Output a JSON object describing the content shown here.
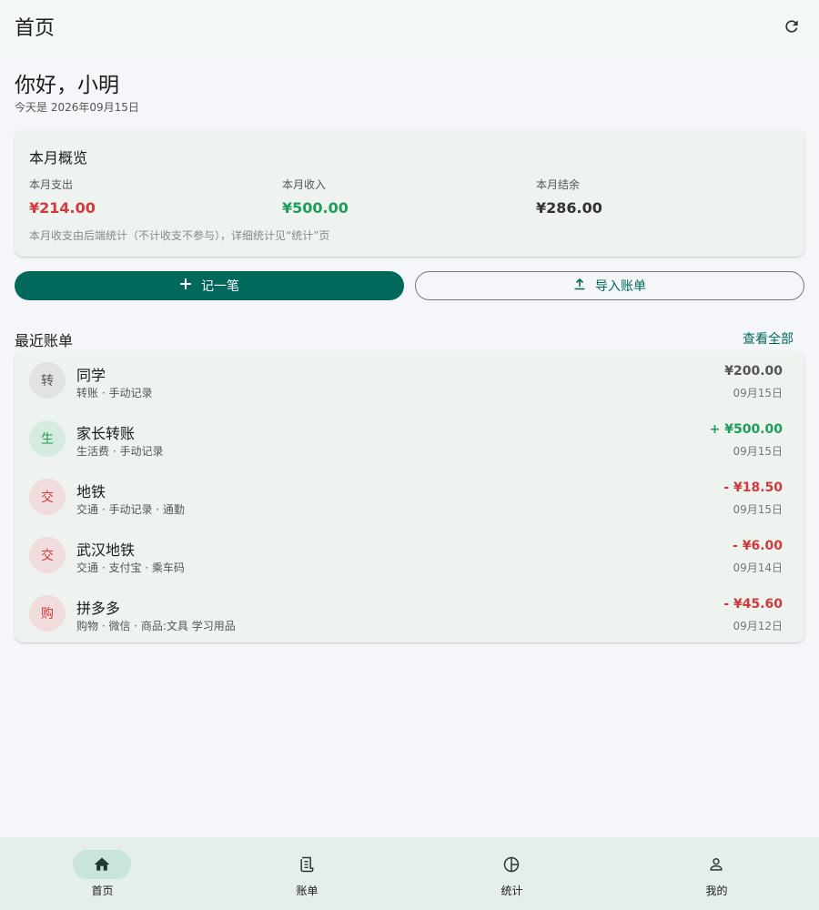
{
  "appbar": {
    "title": "首页",
    "refresh_icon": "refresh-icon"
  },
  "greeting": "你好，小明",
  "date_line": "今天是 2026年09月15日",
  "summary": {
    "title": "本月概览",
    "expense_label": "本月支出",
    "expense_value": "¥214.00",
    "income_label": "本月收入",
    "income_value": "¥500.00",
    "balance_label": "本月结余",
    "balance_value": "¥286.00",
    "note": "本月收支由后端统计（不计收支不参与），详细统计见“统计”页"
  },
  "actions": {
    "add_label": "记一笔",
    "add_icon": "plus-icon",
    "import_label": "导入账单",
    "import_icon": "upload-icon"
  },
  "recent": {
    "title": "最近账单",
    "view_all": "查看全部",
    "items": [
      {
        "avatar": "转",
        "name": "同学",
        "sub": "转账 · 手动记录",
        "amount": "¥200.00",
        "date": "09月15日",
        "kind": "neutral",
        "avatar_type": "transfer"
      },
      {
        "avatar": "生",
        "name": "家长转账",
        "sub": "生活费 · 手动记录",
        "amount": "+ ¥500.00",
        "date": "09月15日",
        "kind": "positive",
        "avatar_type": "living"
      },
      {
        "avatar": "交",
        "name": "地铁",
        "sub": "交通 · 手动记录 · 通勤",
        "amount": "- ¥18.50",
        "date": "09月15日",
        "kind": "negative",
        "avatar_type": "expense"
      },
      {
        "avatar": "交",
        "name": "武汉地铁",
        "sub": "交通 · 支付宝 · 乘车码",
        "amount": "- ¥6.00",
        "date": "09月14日",
        "kind": "negative",
        "avatar_type": "expense"
      },
      {
        "avatar": "购",
        "name": "拼多多",
        "sub": "购物 · 微信 · 商品:文具 学习用品",
        "amount": "- ¥45.60",
        "date": "09月12日",
        "kind": "negative",
        "avatar_type": "expense"
      }
    ]
  },
  "nav": {
    "items": [
      {
        "label": "首页",
        "icon": "home-icon",
        "active": true
      },
      {
        "label": "账单",
        "icon": "receipt-icon",
        "active": false
      },
      {
        "label": "统计",
        "icon": "pie-chart-icon",
        "active": false
      },
      {
        "label": "我的",
        "icon": "person-icon",
        "active": false
      }
    ]
  },
  "colors": {
    "primary": "#00695c",
    "income": "#1e9c5a",
    "expense": "#d03a3a",
    "background": "#f5f6f9"
  }
}
